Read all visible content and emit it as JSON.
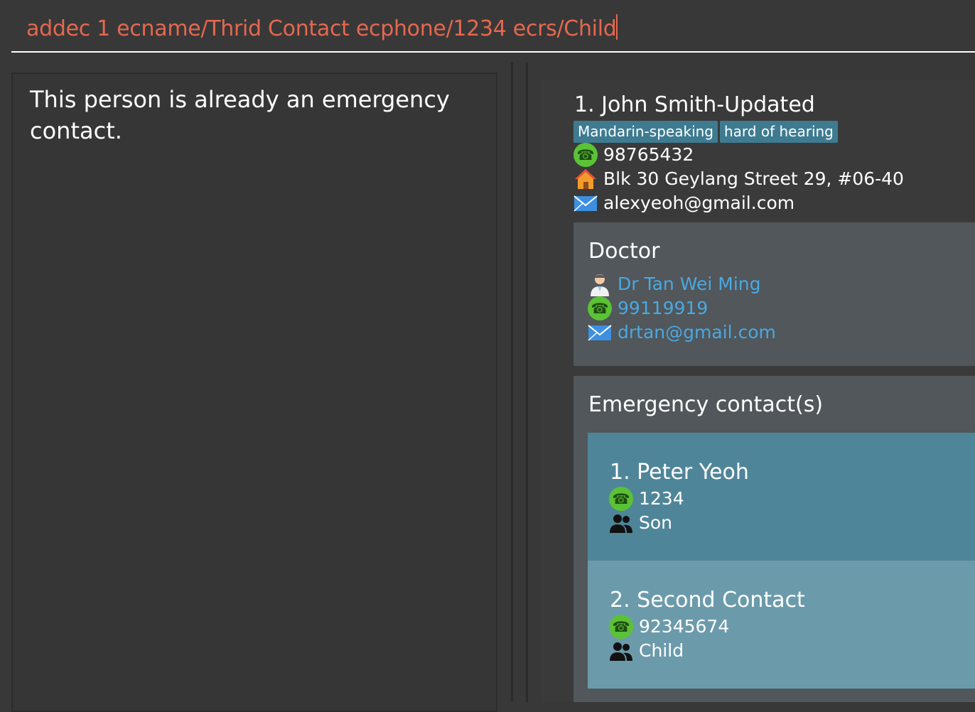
{
  "command_box": {
    "value": "addec 1 ecname/Thrid Contact ecphone/1234 ecrs/Child"
  },
  "result_display": {
    "message": "This person is already an emergency contact."
  },
  "person": {
    "name": "1. John Smith-Updated",
    "tags": [
      "Mandarin-speaking",
      "hard of hearing"
    ],
    "phone": "98765432",
    "address": "Blk 30 Geylang Street 29, #06-40",
    "email": "alexyeoh@gmail.com"
  },
  "doctor": {
    "title": "Doctor",
    "name": "Dr Tan Wei Ming",
    "phone": "99119919",
    "email": "drtan@gmail.com"
  },
  "emergency_contacts": {
    "title": "Emergency contact(s)",
    "items": [
      {
        "name": "1. Peter Yeoh",
        "phone": "1234",
        "relationship": "Son"
      },
      {
        "name": "2. Second Contact",
        "phone": "92345674",
        "relationship": "Child"
      }
    ]
  },
  "colors": {
    "command_text": "#e5684f",
    "tag_bg": "#3e7b91",
    "doctor_link": "#4aa8e2",
    "ec_card_selected": "#4f8599",
    "ec_card": "#6b9bab",
    "phone_icon": "#5bc236"
  },
  "icons": {
    "phone": "phone-icon",
    "address": "home-icon",
    "email": "envelope-icon",
    "doctor": "doctor-icon",
    "relationship": "people-icon"
  }
}
